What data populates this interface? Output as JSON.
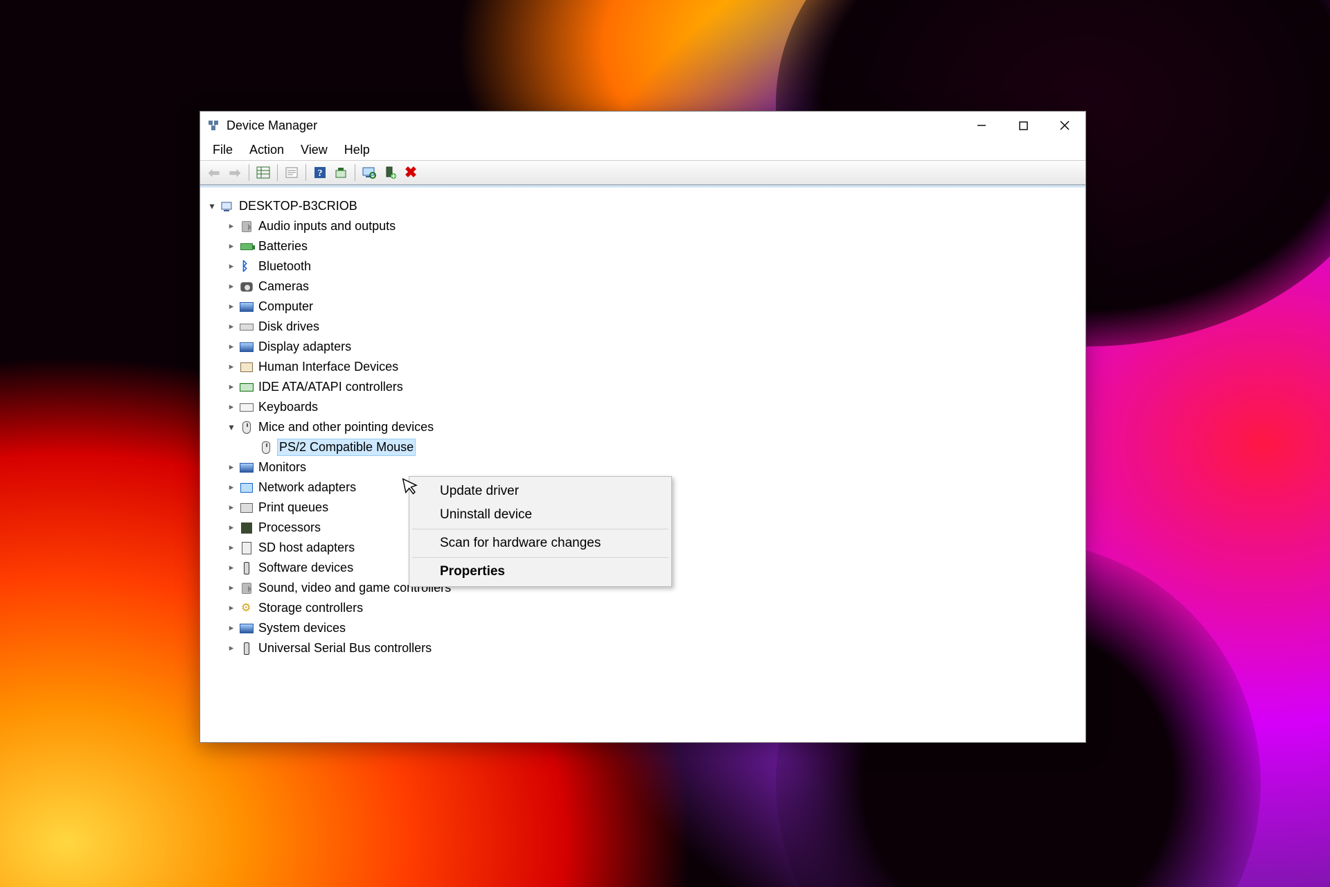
{
  "window": {
    "title": "Device Manager"
  },
  "menu": {
    "file": "File",
    "action": "Action",
    "view": "View",
    "help": "Help"
  },
  "root": {
    "name": "DESKTOP-B3CRIOB"
  },
  "categories": [
    {
      "label": "Audio inputs and outputs",
      "icon": "speaker"
    },
    {
      "label": "Batteries",
      "icon": "battery"
    },
    {
      "label": "Bluetooth",
      "icon": "bluetooth"
    },
    {
      "label": "Cameras",
      "icon": "camera"
    },
    {
      "label": "Computer",
      "icon": "monitor"
    },
    {
      "label": "Disk drives",
      "icon": "disk"
    },
    {
      "label": "Display adapters",
      "icon": "monitor"
    },
    {
      "label": "Human Interface Devices",
      "icon": "hid"
    },
    {
      "label": "IDE ATA/ATAPI controllers",
      "icon": "card"
    },
    {
      "label": "Keyboards",
      "icon": "keyboard"
    },
    {
      "label": "Mice and other pointing devices",
      "icon": "mouse",
      "expanded": true,
      "children": [
        {
          "label": "PS/2 Compatible Mouse",
          "icon": "mouse",
          "selected": true
        }
      ]
    },
    {
      "label": "Monitors",
      "icon": "monitor"
    },
    {
      "label": "Network adapters",
      "icon": "net"
    },
    {
      "label": "Print queues",
      "icon": "printer"
    },
    {
      "label": "Processors",
      "icon": "chip"
    },
    {
      "label": "SD host adapters",
      "icon": "sd"
    },
    {
      "label": "Software devices",
      "icon": "usb"
    },
    {
      "label": "Sound, video and game controllers",
      "icon": "speaker"
    },
    {
      "label": "Storage controllers",
      "icon": "gear"
    },
    {
      "label": "System devices",
      "icon": "monitor"
    },
    {
      "label": "Universal Serial Bus controllers",
      "icon": "usb"
    }
  ],
  "context_menu": {
    "update": "Update driver",
    "uninstall": "Uninstall device",
    "scan": "Scan for hardware changes",
    "properties": "Properties"
  }
}
